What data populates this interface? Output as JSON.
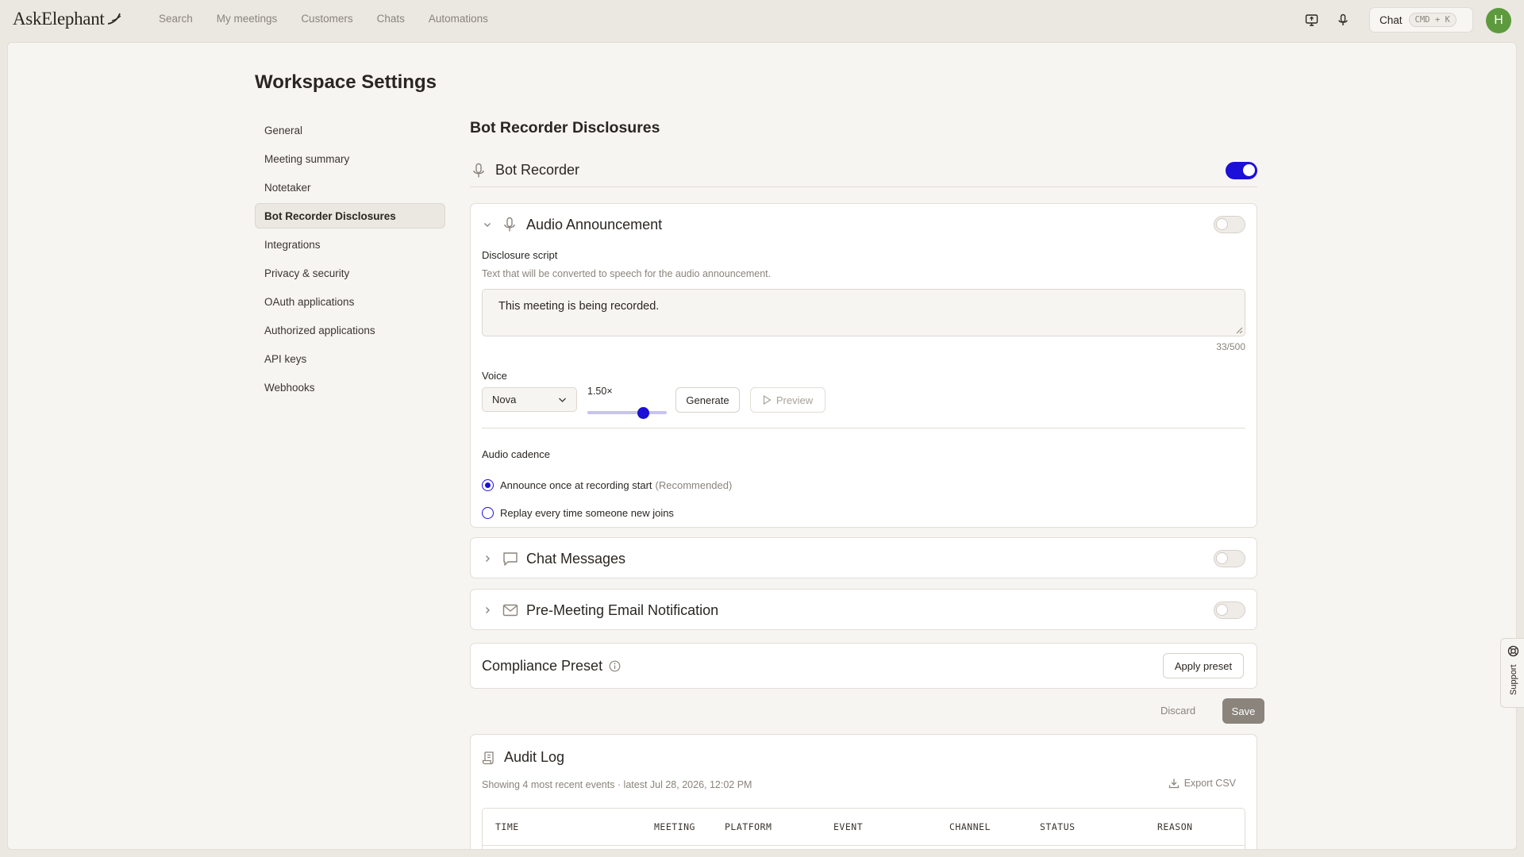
{
  "app": {
    "logo_text": "AskElephant"
  },
  "nav": {
    "items": [
      "Search",
      "My meetings",
      "Customers",
      "Chats",
      "Automations"
    ]
  },
  "topbar": {
    "chat_label": "Chat",
    "chat_shortcut": "CMD + K",
    "avatar_initial": "H",
    "avatar_color": "#5d9a3e"
  },
  "page": {
    "title": "Workspace Settings"
  },
  "sidebar": {
    "items": [
      {
        "label": "General"
      },
      {
        "label": "Meeting summary"
      },
      {
        "label": "Notetaker"
      },
      {
        "label": "Bot Recorder Disclosures",
        "active": true
      },
      {
        "label": "Integrations"
      },
      {
        "label": "Privacy & security"
      },
      {
        "label": "OAuth applications"
      },
      {
        "label": "Authorized applications"
      },
      {
        "label": "API keys"
      },
      {
        "label": "Webhooks"
      }
    ]
  },
  "section": {
    "title": "Bot Recorder Disclosures",
    "bot_recorder": {
      "label": "Bot Recorder",
      "enabled": true
    }
  },
  "audio": {
    "title": "Audio Announcement",
    "enabled": false,
    "script_label": "Disclosure script",
    "script_help": "Text that will be converted to speech for the audio announcement.",
    "script_value": "This meeting is being recorded.",
    "char_count": "33/500",
    "voice_label": "Voice",
    "voice_value": "Nova",
    "speed_label": "1.50×",
    "speed_fraction": 0.7,
    "generate_label": "Generate",
    "preview_label": "Preview",
    "cadence_label": "Audio cadence",
    "cadence_options": [
      {
        "label": "Announce once at recording start",
        "note": "(Recommended)",
        "checked": true
      },
      {
        "label": "Replay every time someone new joins",
        "note": "",
        "checked": false
      }
    ]
  },
  "chat_messages": {
    "title": "Chat Messages",
    "enabled": false
  },
  "email": {
    "title": "Pre-Meeting Email Notification",
    "enabled": false
  },
  "compliance": {
    "title": "Compliance Preset",
    "apply_label": "Apply preset"
  },
  "actions": {
    "discard_label": "Discard",
    "save_label": "Save"
  },
  "audit": {
    "title": "Audit Log",
    "subtitle": "Showing 4 most recent events · latest Jul 28, 2026, 12:02 PM",
    "export_label": "Export CSV",
    "columns": [
      "TIME",
      "MEETING",
      "PLATFORM",
      "EVENT",
      "CHANNEL",
      "STATUS",
      "REASON"
    ]
  },
  "support": {
    "label": "Support"
  },
  "colors": {
    "accent": "#1b0fd8",
    "background": "#ebe7e1",
    "panel": "#f7f5f2"
  }
}
